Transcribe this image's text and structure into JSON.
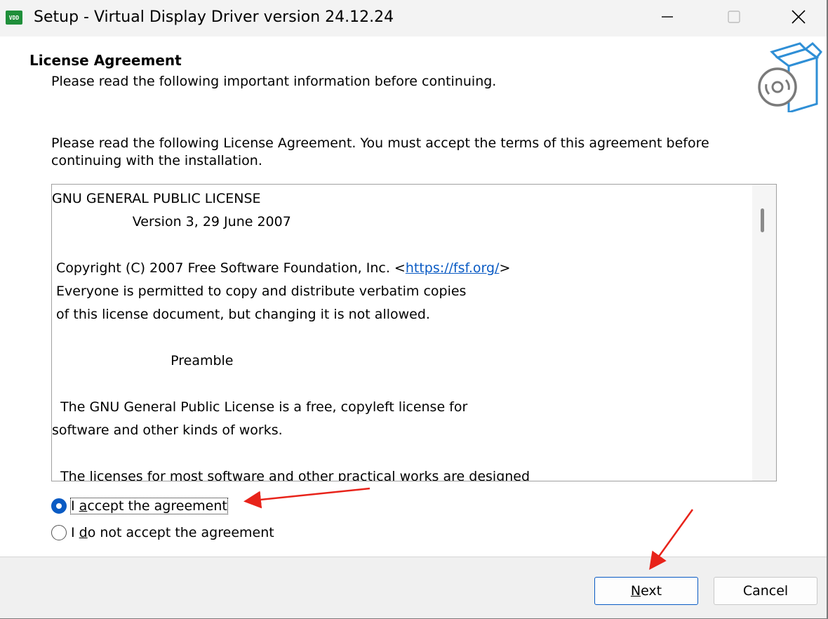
{
  "window": {
    "title": "Setup - Virtual Display Driver version 24.12.24",
    "app_icon_text": "VDD"
  },
  "header": {
    "title": "License Agreement",
    "subtitle": "Please read the following important information before continuing."
  },
  "intro_text": "Please read the following License Agreement. You must accept the terms of this agreement before continuing with the installation.",
  "license": {
    "line_1": "GNU GENERAL PUBLIC LICENSE",
    "line_2": "                   Version 3, 29 June 2007",
    "line_3": "",
    "line_4_prefix": " Copyright (C) 2007 Free Software Foundation, Inc. <",
    "line_4_link": "https://fsf.org/",
    "line_4_suffix": ">",
    "line_5": " Everyone is permitted to copy and distribute verbatim copies",
    "line_6": " of this license document, but changing it is not allowed.",
    "line_7": "",
    "line_8": "                            Preamble",
    "line_9": "",
    "line_10": "  The GNU General Public License is a free, copyleft license for",
    "line_11": "software and other kinds of works.",
    "line_12": "",
    "line_13": "  The licenses for most software and other practical works are designed"
  },
  "options": {
    "accept_label_prefix": "I ",
    "accept_label_accel": "a",
    "accept_label_rest": "ccept the agreement",
    "accept_selected": true,
    "decline_label_prefix": "I ",
    "decline_label_accel": "d",
    "decline_label_rest": "o not accept the agreement",
    "decline_selected": false
  },
  "buttons": {
    "next_accel": "N",
    "next_rest": "ext",
    "cancel": "Cancel"
  },
  "colors": {
    "accent": "#0a5bc4",
    "annotation_arrow": "#e8231a",
    "app_icon": "#1f8f3a"
  }
}
